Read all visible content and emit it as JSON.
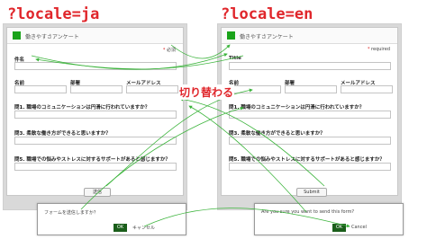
{
  "headings": {
    "ja": "?locale=ja",
    "en": "?locale=en"
  },
  "switch_label": "切り替わる",
  "form_ja": {
    "title": "働きやすさアンケート",
    "required_note": "必須",
    "labels": {
      "title": "件名",
      "name": "名前",
      "department": "部署",
      "email": "メールアドレス",
      "q1": "問1. 職場のコミュニケーションは円滑に行われていますか？",
      "q3": "問3. 柔軟な働き方ができると思いますか？",
      "q5": "問5. 職場での悩みやストレスに対するサポートがあると感じますか？"
    },
    "submit": "送信"
  },
  "form_en": {
    "title": "働きやすさアンケート",
    "required_note": "required",
    "labels": {
      "title": "Title",
      "name": "名前",
      "department": "部署",
      "email": "メールアドレス",
      "q1": "問1. 職場のコミュニケーションは円滑に行われていますか？",
      "q3": "問3. 柔軟な働き方ができると思いますか？",
      "q5": "問5. 職場での悩みやストレスに対するサポートがあると感じますか？"
    },
    "submit": "Submit"
  },
  "dialog_ja": {
    "message": "フォームを送信しますか？",
    "ok": "OK",
    "cancel": "キャンセル"
  },
  "dialog_en": {
    "message": "Are you sure you want to send this form?",
    "ok": "OK",
    "cancel": "Cancel"
  },
  "colors": {
    "accent_red": "#e0262b",
    "header_green": "#1aa31a",
    "ok_button": "#1a5e1a",
    "arrow_green": "#3cb43c"
  }
}
